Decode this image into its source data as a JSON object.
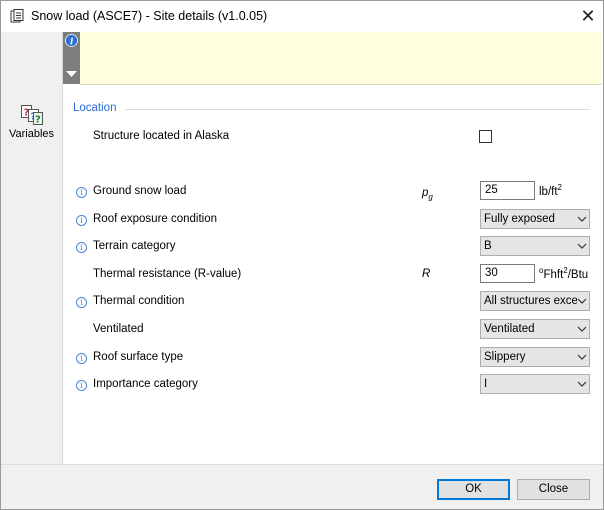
{
  "window": {
    "title": "Snow load (ASCE7) - Site details (v1.0.05)",
    "close_glyph": "✕"
  },
  "sidebar": {
    "variables_label": "Variables",
    "variables_icon": "variables-icon"
  },
  "section": {
    "title": "Location"
  },
  "rows": {
    "alaska": {
      "label": "Structure located in Alaska",
      "checked": false
    },
    "ground_snow": {
      "label": "Ground snow load",
      "symbol": "p",
      "symbol_sub": "g",
      "value": "25",
      "unit": "lb/ft",
      "unit_sup": "2"
    },
    "roof_exposure": {
      "label": "Roof exposure condition",
      "value": "Fully exposed"
    },
    "terrain": {
      "label": "Terrain category",
      "value": "B"
    },
    "thermal_resistance": {
      "label": "Thermal resistance (R-value)",
      "symbol": "R",
      "value": "30",
      "unit_pre": "o",
      "unit_main": "Fhft",
      "unit_sup": "2",
      "unit_post": "/Btu"
    },
    "thermal_condition": {
      "label": "Thermal condition",
      "value": "All structures exce"
    },
    "ventilated": {
      "label": "Ventilated",
      "value": "Ventilated"
    },
    "roof_surface": {
      "label": "Roof surface type",
      "value": "Slippery"
    },
    "importance": {
      "label": "Importance category",
      "value": "I"
    }
  },
  "info_glyph": "i",
  "footer": {
    "ok_label": "OK",
    "cancel_label": "Close"
  },
  "colors": {
    "accent": "#2a6bd4",
    "info_panel": "#ffffdf",
    "info_strip": "#7d7d7d",
    "ok_border": "#0078d7"
  }
}
